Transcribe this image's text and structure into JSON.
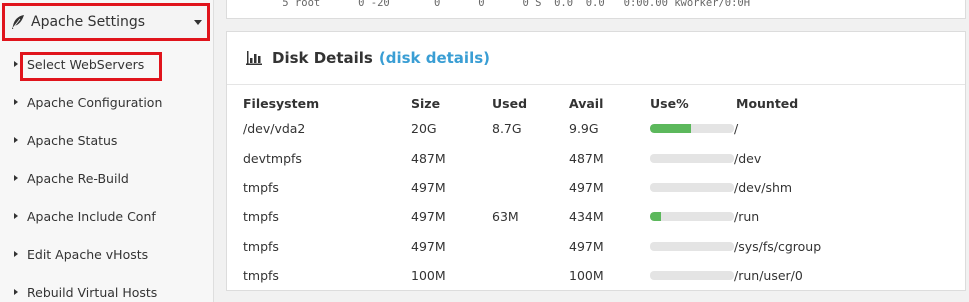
{
  "sidebar": {
    "section_title": "Apache Settings",
    "section_icon": "feather-icon",
    "items": [
      {
        "label": "Select WebServers",
        "highlighted": true
      },
      {
        "label": "Apache Configuration"
      },
      {
        "label": "Apache Status"
      },
      {
        "label": "Apache Re-Build"
      },
      {
        "label": "Apache Include Conf"
      },
      {
        "label": "Edit Apache vHosts"
      },
      {
        "label": "Rebuild Virtual Hosts"
      }
    ]
  },
  "process_panel": {
    "line": "    5 root      0 -20       0      0      0 S  0.0  0.0   0:00.00 kworker/0:0H"
  },
  "disk_panel": {
    "icon": "bar-chart-icon",
    "title": "Disk Details",
    "link": "(disk details)",
    "accent_color": "#3a9ed4",
    "bar_color": "#5cb85c",
    "columns": [
      "Filesystem",
      "Size",
      "Used",
      "Avail",
      "Use%",
      "Mounted"
    ],
    "rows": [
      {
        "filesystem": "/dev/vda2",
        "size": "20G",
        "used": "8.7G",
        "avail": "9.9G",
        "use_fraction": 0.49,
        "mounted": "/"
      },
      {
        "filesystem": "devtmpfs",
        "size": "487M",
        "used": "",
        "avail": "487M",
        "use_fraction": 0,
        "mounted": "/dev"
      },
      {
        "filesystem": "tmpfs",
        "size": "497M",
        "used": "",
        "avail": "497M",
        "use_fraction": 0,
        "mounted": "/dev/shm"
      },
      {
        "filesystem": "tmpfs",
        "size": "497M",
        "used": "63M",
        "avail": "434M",
        "use_fraction": 0.13,
        "mounted": "/run"
      },
      {
        "filesystem": "tmpfs",
        "size": "497M",
        "used": "",
        "avail": "497M",
        "use_fraction": 0,
        "mounted": "/sys/fs/cgroup"
      },
      {
        "filesystem": "tmpfs",
        "size": "100M",
        "used": "",
        "avail": "100M",
        "use_fraction": 0,
        "mounted": "/run/user/0"
      }
    ]
  }
}
